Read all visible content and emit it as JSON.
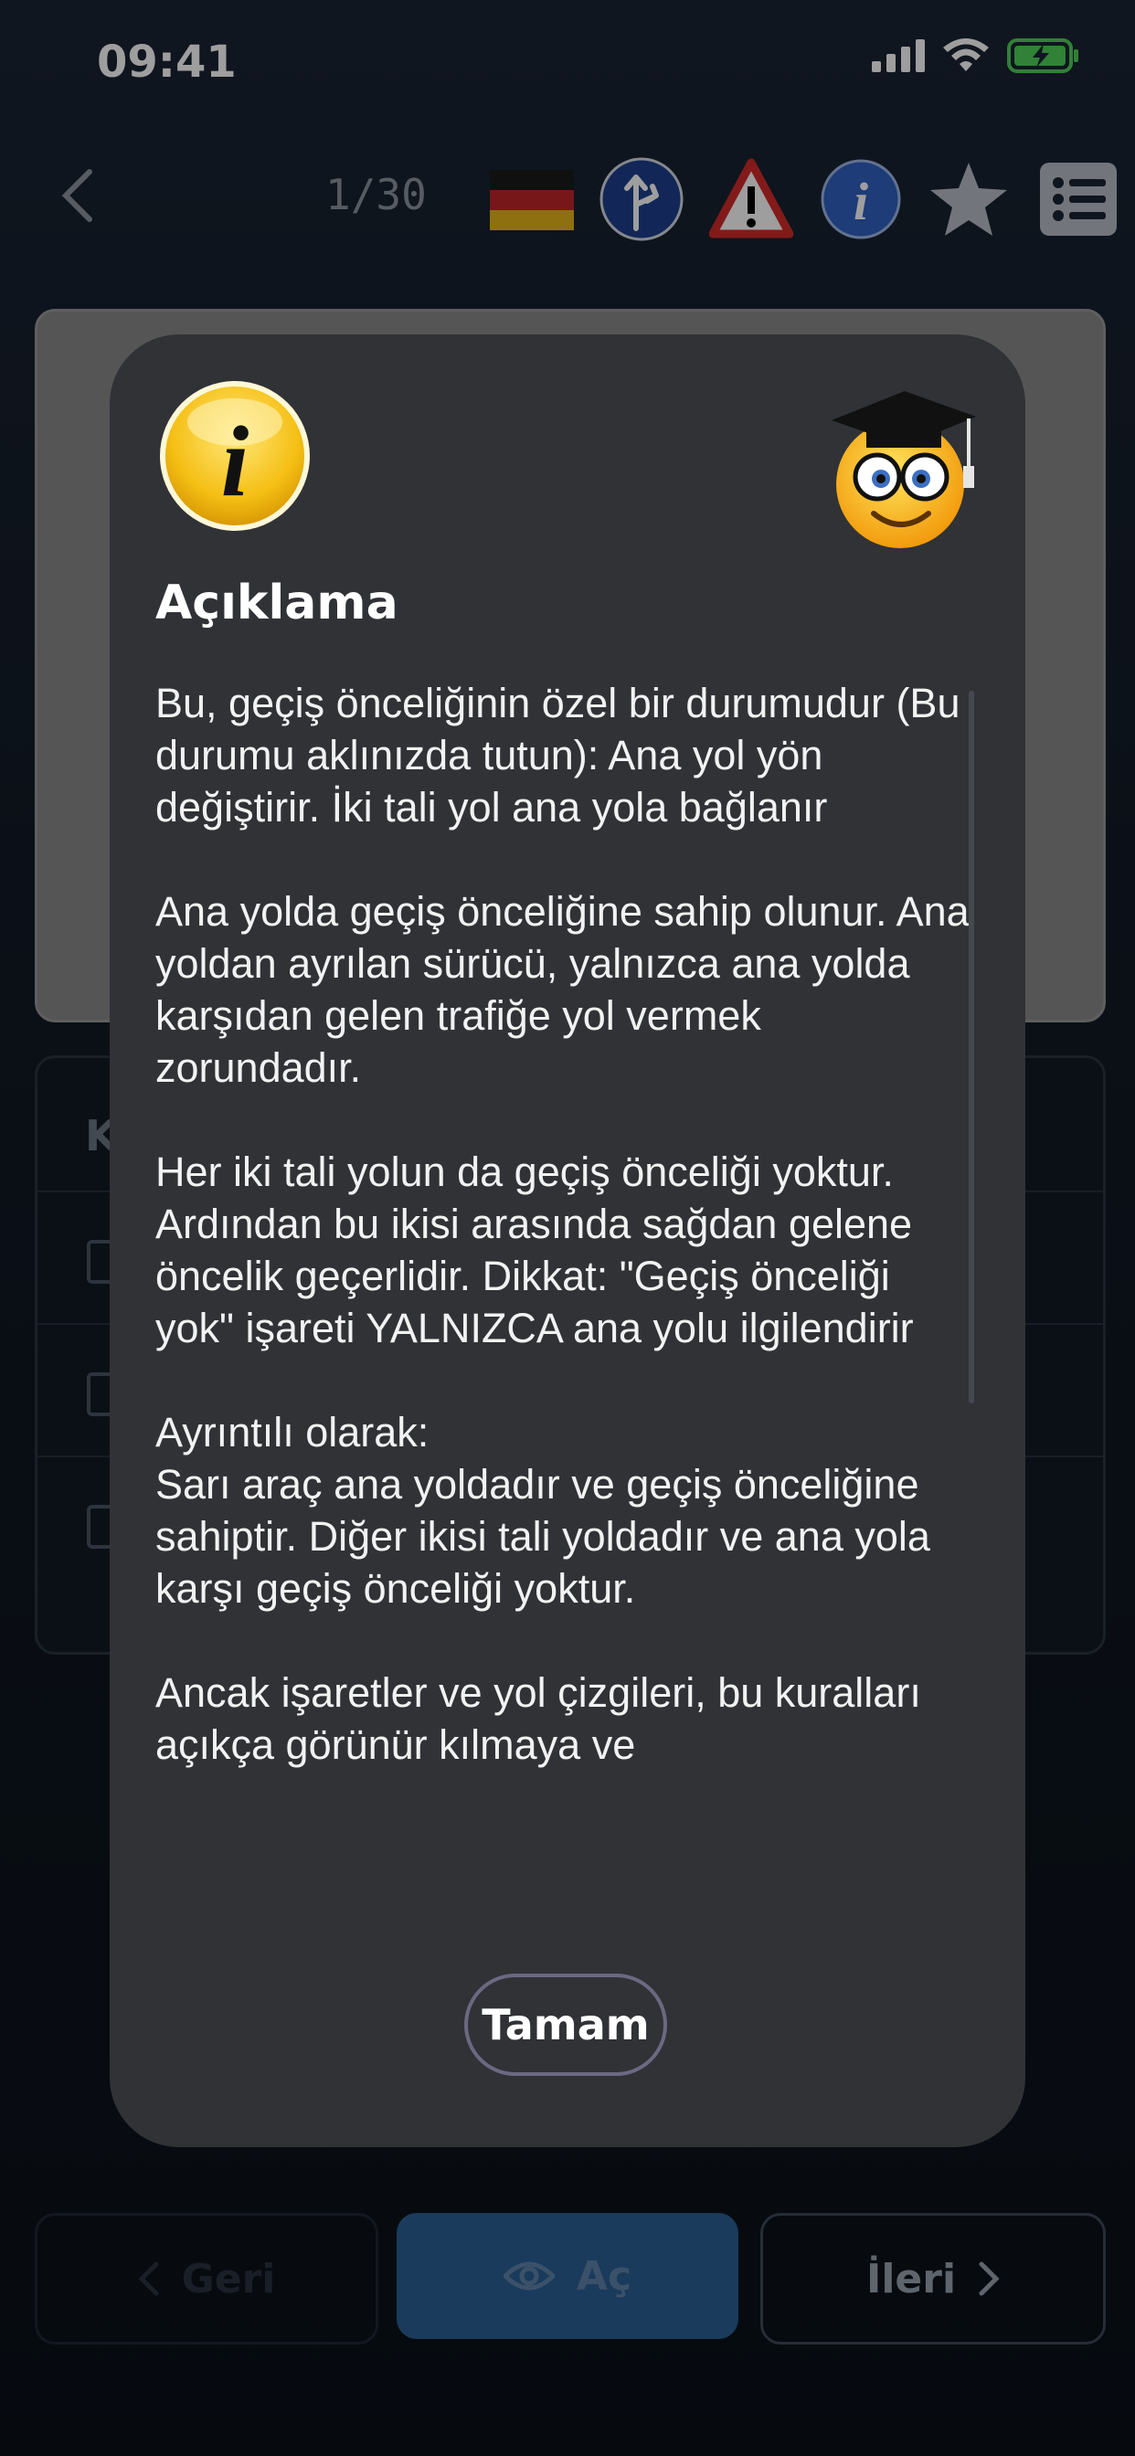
{
  "status_bar": {
    "time": "09:41"
  },
  "toolbar": {
    "counter": "1/30"
  },
  "background": {
    "list_header_fragment": "K"
  },
  "bottom_nav": {
    "back_label": "Geri",
    "reveal_label": "Aç",
    "next_label": "İleri"
  },
  "modal": {
    "title": "Açıklama",
    "body": "Bu, geçiş önceliğinin özel bir durumudur (Bu durumu aklınızda tutun): Ana yol yön değiştirir. İki tali yol ana yola bağlanır\n\nAna yolda geçiş önceliğine sahip olunur. Ana yoldan ayrılan sürücü, yalnızca ana yolda karşıdan gelen trafiğe yol vermek zorundadır.\n\nHer iki tali yolun da geçiş önceliği yoktur. Ardından bu ikisi arasında sağdan gelene öncelik geçerlidir. Dikkat: \"Geçiş önceliği yok\" işareti YALNIZCA ana yolu ilgilendirir\n\nAyrıntılı olarak:\nSarı araç ana yoldadır ve geçiş önceliğine sahiptir. Diğer ikisi tali yoldadır ve ana yola karşı geçiş önceliği yoktur.\n\nAncak işaretler ve yol çizgileri, bu kuralları açıkça görünür kılmaya ve",
    "ok_label": "Tamam"
  },
  "colors": {
    "modal_bg": "#303236",
    "accent_button": "#2b5f93",
    "ok_border": "#6c6882"
  },
  "icons": [
    "back-chevron-icon",
    "german-flag-icon",
    "priority-road-sign-icon",
    "warning-sign-icon",
    "info-icon",
    "star-icon",
    "list-icon",
    "signal-icon",
    "wifi-icon",
    "battery-icon",
    "eye-icon",
    "graduate-emoji-icon"
  ]
}
